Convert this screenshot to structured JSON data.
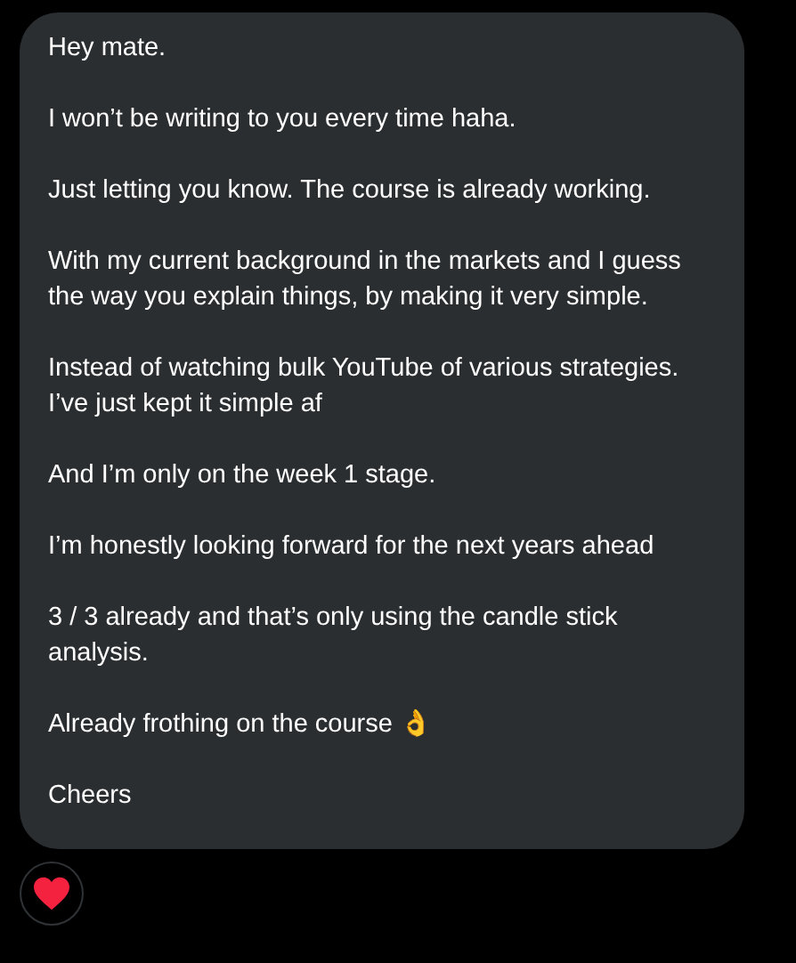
{
  "message": {
    "paragraphs": [
      "Hey mate.",
      "I won’t be writing to you every time haha.",
      "Just letting you know. The course is already working.",
      "With my current background in the markets and I guess the way you explain things, by making it very simple.",
      "Instead of watching bulk YouTube of various strategies. I’ve just kept it simple af",
      "And I’m only on the week 1 stage.",
      "I’m honestly looking forward for the next years ahead",
      "3 / 3 already and that’s only using the candle stick analysis.",
      "Already frothing on the course 👌",
      "Cheers"
    ]
  },
  "reaction": {
    "kind": "heart"
  }
}
